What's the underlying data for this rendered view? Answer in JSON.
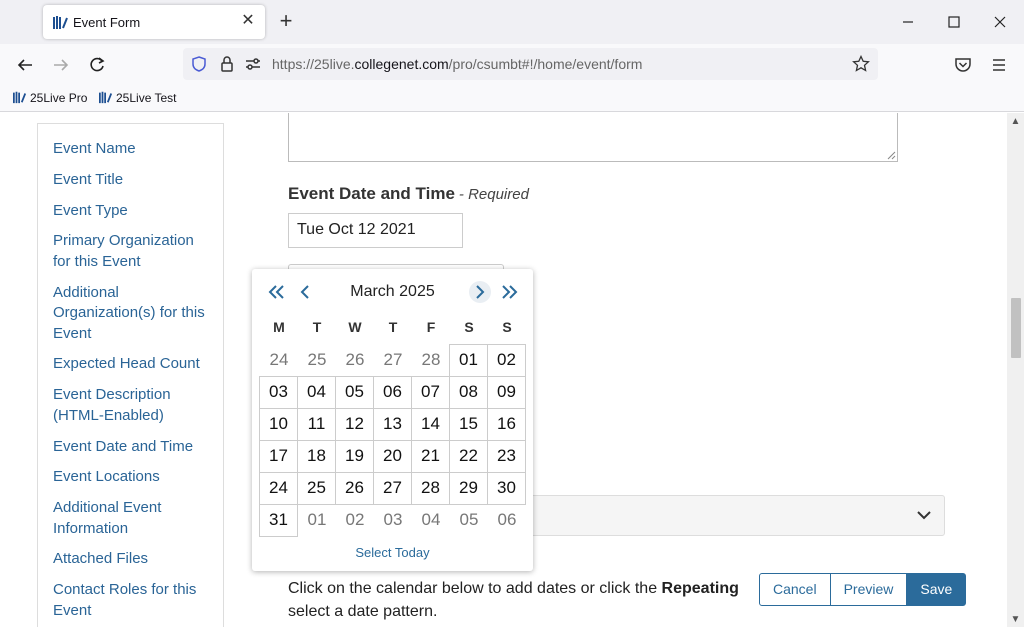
{
  "browser": {
    "tab_title": "Event Form",
    "url_prefix": "https://25live.",
    "url_host": "collegenet.com",
    "url_path": "/pro/csumbt#!/home/event/form",
    "bookmarks": [
      "25Live Pro",
      "25Live Test"
    ]
  },
  "sidenav": {
    "items": [
      "Event Name",
      "Event Title",
      "Event Type",
      "Primary Organization for this Event",
      "Additional Organization(s) for this Event",
      "Expected Head Count",
      "Event Description (HTML-Enabled)",
      "Event Date and Time",
      "Event Locations",
      "Additional Event Information",
      "Attached Files",
      "Contact Roles for this Event"
    ]
  },
  "form": {
    "date_heading": "Event Date and Time",
    "required_label": "- Required",
    "date_value": "Tue Oct 12 2021",
    "help_text_before": "Click on the calendar below to add dates or click the ",
    "help_text_bold": "Repeating",
    "help_text_after": "select a date pattern."
  },
  "buttons": {
    "cancel": "Cancel",
    "preview": "Preview",
    "save": "Save"
  },
  "datepicker": {
    "title": "March 2025",
    "weekdays": [
      "M",
      "T",
      "W",
      "T",
      "F",
      "S",
      "S"
    ],
    "days": [
      {
        "d": "24",
        "in": false
      },
      {
        "d": "25",
        "in": false
      },
      {
        "d": "26",
        "in": false
      },
      {
        "d": "27",
        "in": false
      },
      {
        "d": "28",
        "in": false
      },
      {
        "d": "01",
        "in": true
      },
      {
        "d": "02",
        "in": true
      },
      {
        "d": "03",
        "in": true
      },
      {
        "d": "04",
        "in": true
      },
      {
        "d": "05",
        "in": true
      },
      {
        "d": "06",
        "in": true
      },
      {
        "d": "07",
        "in": true
      },
      {
        "d": "08",
        "in": true
      },
      {
        "d": "09",
        "in": true
      },
      {
        "d": "10",
        "in": true
      },
      {
        "d": "11",
        "in": true
      },
      {
        "d": "12",
        "in": true
      },
      {
        "d": "13",
        "in": true
      },
      {
        "d": "14",
        "in": true
      },
      {
        "d": "15",
        "in": true
      },
      {
        "d": "16",
        "in": true
      },
      {
        "d": "17",
        "in": true
      },
      {
        "d": "18",
        "in": true
      },
      {
        "d": "19",
        "in": true
      },
      {
        "d": "20",
        "in": true
      },
      {
        "d": "21",
        "in": true
      },
      {
        "d": "22",
        "in": true
      },
      {
        "d": "23",
        "in": true
      },
      {
        "d": "24",
        "in": true
      },
      {
        "d": "25",
        "in": true
      },
      {
        "d": "26",
        "in": true
      },
      {
        "d": "27",
        "in": true
      },
      {
        "d": "28",
        "in": true
      },
      {
        "d": "29",
        "in": true
      },
      {
        "d": "30",
        "in": true
      },
      {
        "d": "31",
        "in": true
      },
      {
        "d": "01",
        "in": false
      },
      {
        "d": "02",
        "in": false
      },
      {
        "d": "03",
        "in": false
      },
      {
        "d": "04",
        "in": false
      },
      {
        "d": "05",
        "in": false
      },
      {
        "d": "06",
        "in": false
      }
    ],
    "select_today": "Select Today"
  }
}
